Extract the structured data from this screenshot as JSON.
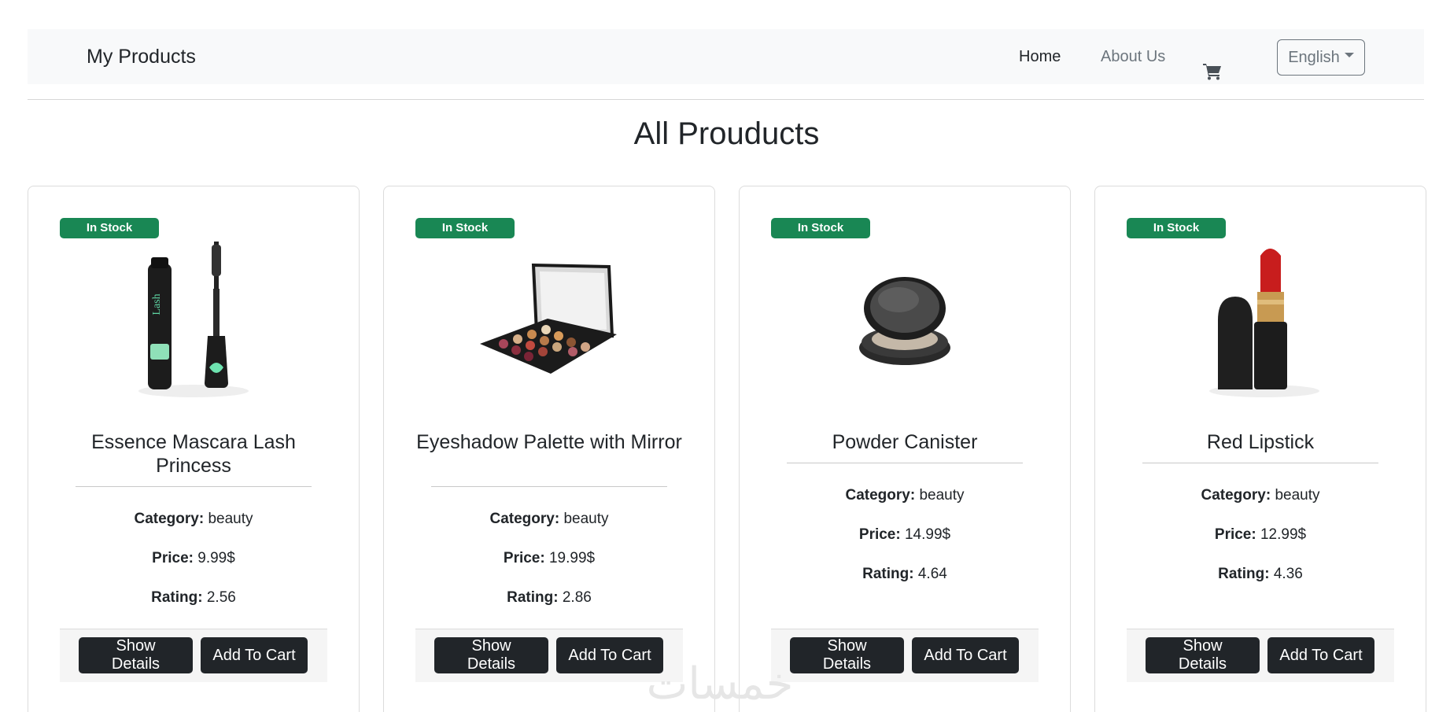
{
  "navbar": {
    "brand": "My Products",
    "links": [
      {
        "label": "Home",
        "active": true
      },
      {
        "label": "About Us",
        "active": false
      }
    ],
    "cart_icon": "cart-icon",
    "language": "English"
  },
  "page_title": "All Prouducts",
  "products": [
    {
      "badge": "In Stock",
      "name": "Essence Mascara Lash Princess",
      "category_label": "Category:",
      "category": "beauty",
      "price_label": "Price:",
      "price": "9.99$",
      "rating_label": "Rating:",
      "rating": "2.56",
      "details_button": "Show Details",
      "cart_button": "Add To Cart"
    },
    {
      "badge": "In Stock",
      "name": "Eyeshadow Palette with Mirror",
      "category_label": "Category:",
      "category": "beauty",
      "price_label": "Price:",
      "price": "19.99$",
      "rating_label": "Rating:",
      "rating": "2.86",
      "details_button": "Show Details",
      "cart_button": "Add To Cart"
    },
    {
      "badge": "In Stock",
      "name": "Powder Canister",
      "category_label": "Category:",
      "category": "beauty",
      "price_label": "Price:",
      "price": "14.99$",
      "rating_label": "Rating:",
      "rating": "4.64",
      "details_button": "Show Details",
      "cart_button": "Add To Cart"
    },
    {
      "badge": "In Stock",
      "name": "Red Lipstick",
      "category_label": "Category:",
      "category": "beauty",
      "price_label": "Price:",
      "price": "12.99$",
      "rating_label": "Rating:",
      "rating": "4.36",
      "details_button": "Show Details",
      "cart_button": "Add To Cart"
    }
  ],
  "colors": {
    "badge": "#198754",
    "button": "#212529",
    "navbar_bg": "#f8f9fa"
  },
  "watermark": "خمسات"
}
